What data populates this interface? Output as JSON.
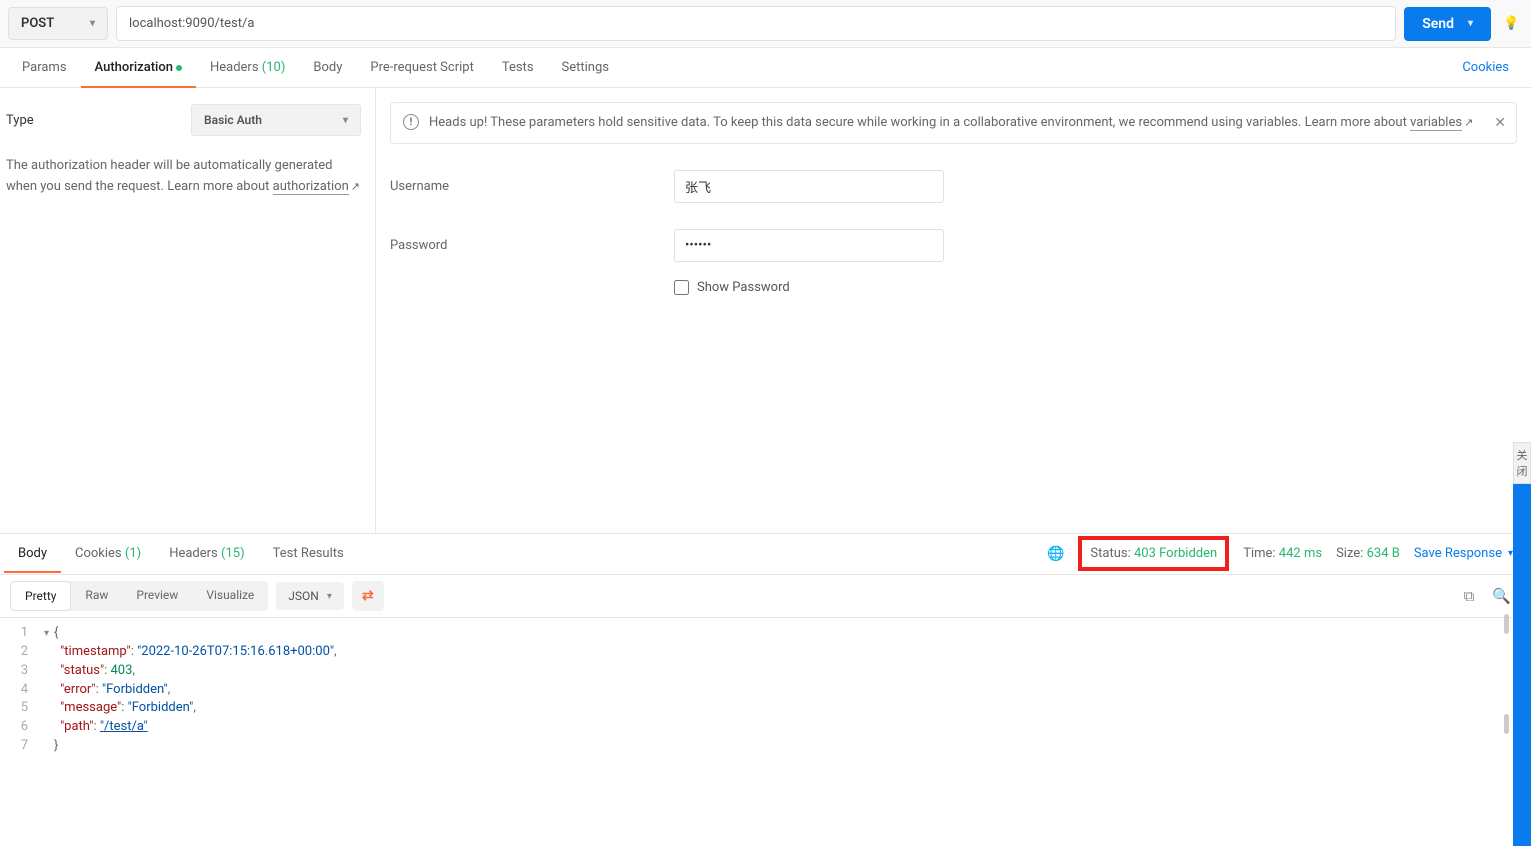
{
  "top": {
    "method": "POST",
    "url": "localhost:9090/test/a",
    "send_label": "Send",
    "bulb_icon": "💡"
  },
  "tabs": {
    "params": "Params",
    "authorization": "Authorization",
    "headers": "Headers",
    "headers_count": "(10)",
    "body": "Body",
    "prerequest": "Pre-request Script",
    "tests": "Tests",
    "settings": "Settings",
    "cookies": "Cookies"
  },
  "auth": {
    "type_label": "Type",
    "type_value": "Basic Auth",
    "desc_before": "The authorization header will be automatically generated when you send the request. Learn more about ",
    "desc_link": "authorization",
    "notice_text": "Heads up! These parameters hold sensitive data. To keep this data secure while working in a collaborative environment, we recommend using variables. Learn more about ",
    "notice_link": "variables",
    "username_label": "Username",
    "username_value": "张飞",
    "password_label": "Password",
    "password_value": "••••••",
    "show_password": "Show Password"
  },
  "response": {
    "tabs": {
      "body": "Body",
      "cookies": "Cookies",
      "cookies_count": "(1)",
      "headers": "Headers",
      "headers_count": "(15)",
      "tests": "Test Results"
    },
    "meta": {
      "status_label": "Status:",
      "status_value": "403 Forbidden",
      "time_label": "Time:",
      "time_value": "442 ms",
      "size_label": "Size:",
      "size_value": "634 B",
      "save": "Save Response"
    },
    "view": {
      "pretty": "Pretty",
      "raw": "Raw",
      "preview": "Preview",
      "visualize": "Visualize",
      "format": "JSON"
    },
    "json": {
      "timestamp_key": "\"timestamp\"",
      "timestamp_val": "\"2022-10-26T07:15:16.618+00:00\"",
      "status_key": "\"status\"",
      "status_val": "403",
      "error_key": "\"error\"",
      "error_val": "\"Forbidden\"",
      "message_key": "\"message\"",
      "message_val": "\"Forbidden\"",
      "path_key": "\"path\"",
      "path_val": "\"/test/a\""
    }
  },
  "rail": {
    "close": "关闭"
  }
}
